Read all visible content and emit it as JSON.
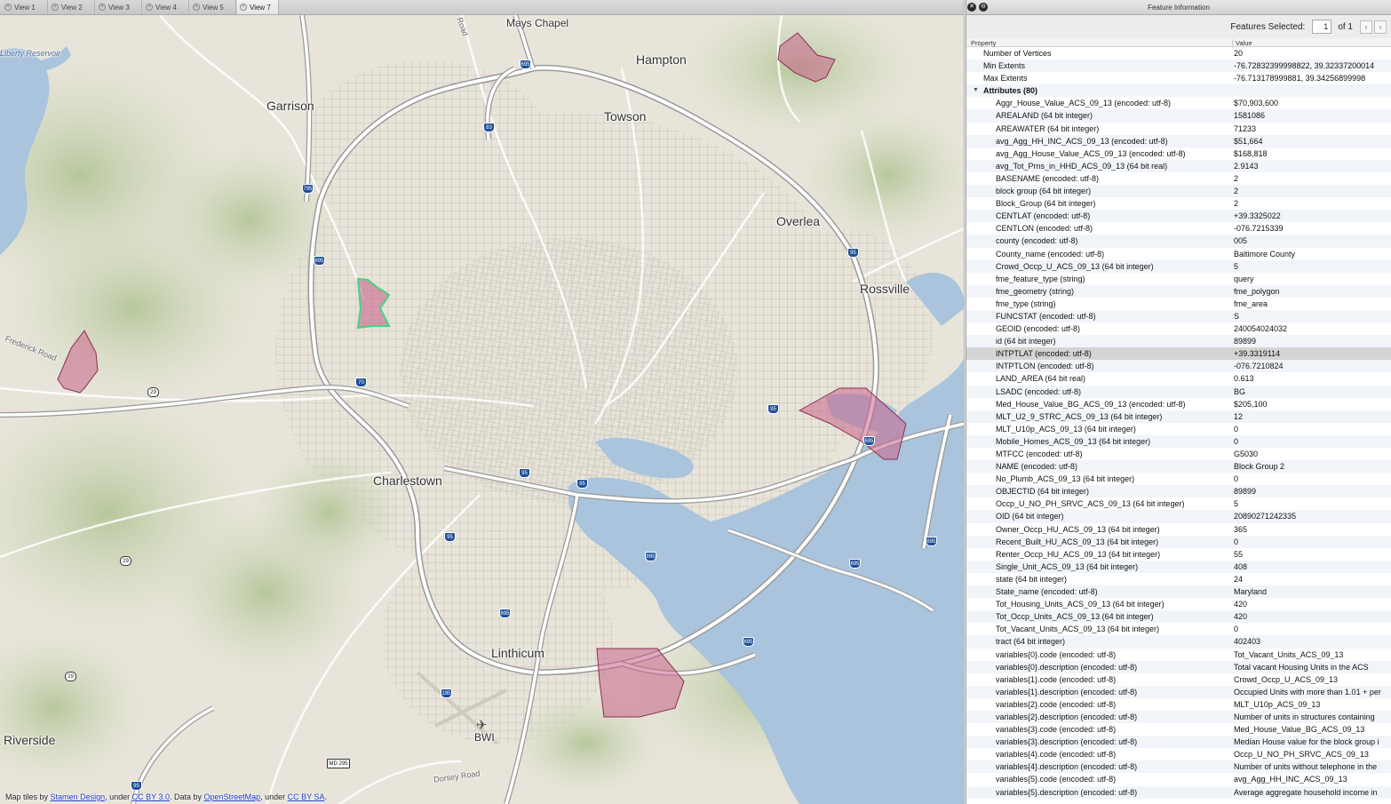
{
  "tabs": [
    "View 1",
    "View 2",
    "View 3",
    "View 4",
    "View 5",
    "View 7"
  ],
  "active_tab": "View 7",
  "map": {
    "places": [
      {
        "name": "Mays Chapel"
      },
      {
        "name": "Hampton"
      },
      {
        "name": "Garrison"
      },
      {
        "name": "Towson"
      },
      {
        "name": "Overlea"
      },
      {
        "name": "Rossville"
      },
      {
        "name": "Charlestown"
      },
      {
        "name": "Linthicum"
      },
      {
        "name": "Riverside"
      },
      {
        "name": "BWI"
      },
      {
        "name": "Liberty Reservoir"
      },
      {
        "name": "Frederick Road"
      },
      {
        "name": "Dorsey Road"
      },
      {
        "name": "Road"
      }
    ],
    "shields": [
      "695",
      "83",
      "795",
      "695",
      "70",
      "29",
      "95",
      "95",
      "95",
      "95",
      "895",
      "695",
      "695",
      "695",
      "695",
      "695",
      "195",
      "29",
      "29",
      "95",
      "MD 295",
      "95"
    ],
    "credits": {
      "prefix": "Map tiles by",
      "stamen": "Stamen Design",
      "under1": ", under",
      "cc1": "CC BY 3.0",
      "data_by": ". Data by",
      "osm": "OpenStreetMap",
      "under2": ", under",
      "cc2": "CC BY SA",
      "end": "."
    },
    "colors": {
      "water": "#a9c4dc",
      "highlight_fill": "#c8648a",
      "selected_outline": "#4fd08a",
      "highway": "#ffffff",
      "terrain": "#c9d6b2"
    }
  },
  "panel": {
    "title": "Feature Information",
    "features_selected_label": "Features Selected:",
    "feature_index": "1",
    "of_label": "of 1",
    "prev_icon": "‹",
    "next_icon": "›",
    "header_property": "Property",
    "header_value": "Value",
    "rows": [
      {
        "name": "Number of Vertices",
        "value": "20",
        "type": "top"
      },
      {
        "name": "Min Extents",
        "value": "-76.72832399998822, 39.32337200014",
        "type": "top"
      },
      {
        "name": "Max Extents",
        "value": "-76.713178999881, 39.34256899998",
        "type": "top"
      },
      {
        "name": "Attributes (80)",
        "value": "",
        "type": "group"
      },
      {
        "name": "Aggr_House_Value_ACS_09_13 (encoded: utf-8)",
        "value": "$70,903,600"
      },
      {
        "name": "AREALAND (64 bit integer)",
        "value": "1581086"
      },
      {
        "name": "AREAWATER (64 bit integer)",
        "value": "71233"
      },
      {
        "name": "avg_Agg_HH_INC_ACS_09_13 (encoded: utf-8)",
        "value": "$51,664"
      },
      {
        "name": "avg_Agg_House_Value_ACS_09_13 (encoded: utf-8)",
        "value": "$168,818"
      },
      {
        "name": "avg_Tot_Prns_in_HHD_ACS_09_13 (64 bit real)",
        "value": "2.9143"
      },
      {
        "name": "BASENAME (encoded: utf-8)",
        "value": "2"
      },
      {
        "name": "block group (64 bit integer)",
        "value": "2"
      },
      {
        "name": "Block_Group (64 bit integer)",
        "value": "2"
      },
      {
        "name": "CENTLAT (encoded: utf-8)",
        "value": "+39.3325022"
      },
      {
        "name": "CENTLON (encoded: utf-8)",
        "value": "-076.7215339"
      },
      {
        "name": "county (encoded: utf-8)",
        "value": "005"
      },
      {
        "name": "County_name (encoded: utf-8)",
        "value": "Baltimore County"
      },
      {
        "name": "Crowd_Occp_U_ACS_09_13 (64 bit integer)",
        "value": "5"
      },
      {
        "name": "fme_feature_type (string)",
        "value": "query"
      },
      {
        "name": "fme_geometry (string)",
        "value": "fme_polygon"
      },
      {
        "name": "fme_type (string)",
        "value": "fme_area"
      },
      {
        "name": "FUNCSTAT (encoded: utf-8)",
        "value": "S"
      },
      {
        "name": "GEOID (encoded: utf-8)",
        "value": "240054024032"
      },
      {
        "name": "id (64 bit integer)",
        "value": "89899"
      },
      {
        "name": "INTPTLAT (encoded: utf-8)",
        "value": "+39.3319114",
        "type": "selected"
      },
      {
        "name": "INTPTLON (encoded: utf-8)",
        "value": "-076.7210824"
      },
      {
        "name": "LAND_AREA (64 bit real)",
        "value": "0.613"
      },
      {
        "name": "LSADC (encoded: utf-8)",
        "value": "BG"
      },
      {
        "name": "Med_House_Value_BG_ACS_09_13 (encoded: utf-8)",
        "value": "$205,100"
      },
      {
        "name": "MLT_U2_9_STRC_ACS_09_13 (64 bit integer)",
        "value": "12"
      },
      {
        "name": "MLT_U10p_ACS_09_13 (64 bit integer)",
        "value": "0"
      },
      {
        "name": "Mobile_Homes_ACS_09_13 (64 bit integer)",
        "value": "0"
      },
      {
        "name": "MTFCC (encoded: utf-8)",
        "value": "G5030"
      },
      {
        "name": "NAME (encoded: utf-8)",
        "value": "Block Group 2"
      },
      {
        "name": "No_Plumb_ACS_09_13 (64 bit integer)",
        "value": "0"
      },
      {
        "name": "OBJECTID (64 bit integer)",
        "value": "89899"
      },
      {
        "name": "Occp_U_NO_PH_SRVC_ACS_09_13 (64 bit integer)",
        "value": "5"
      },
      {
        "name": "OID (64 bit integer)",
        "value": "20890271242335"
      },
      {
        "name": "Owner_Occp_HU_ACS_09_13 (64 bit integer)",
        "value": "365"
      },
      {
        "name": "Recent_Built_HU_ACS_09_13 (64 bit integer)",
        "value": "0"
      },
      {
        "name": "Renter_Occp_HU_ACS_09_13 (64 bit integer)",
        "value": "55"
      },
      {
        "name": "Single_Unit_ACS_09_13 (64 bit integer)",
        "value": "408"
      },
      {
        "name": "state (64 bit integer)",
        "value": "24"
      },
      {
        "name": "State_name (encoded: utf-8)",
        "value": "Maryland"
      },
      {
        "name": "Tot_Housing_Units_ACS_09_13 (64 bit integer)",
        "value": "420"
      },
      {
        "name": "Tot_Occp_Units_ACS_09_13 (64 bit integer)",
        "value": "420"
      },
      {
        "name": "Tot_Vacant_Units_ACS_09_13 (64 bit integer)",
        "value": "0"
      },
      {
        "name": "tract (64 bit integer)",
        "value": "402403"
      },
      {
        "name": "variables{0}.code (encoded: utf-8)",
        "value": "Tot_Vacant_Units_ACS_09_13"
      },
      {
        "name": "variables{0}.description (encoded: utf-8)",
        "value": "Total vacant Housing Units in the ACS"
      },
      {
        "name": "variables{1}.code (encoded: utf-8)",
        "value": "Crowd_Occp_U_ACS_09_13"
      },
      {
        "name": "variables{1}.description (encoded: utf-8)",
        "value": "Occupied Units with more than 1.01 + per"
      },
      {
        "name": "variables{2}.code (encoded: utf-8)",
        "value": "MLT_U10p_ACS_09_13"
      },
      {
        "name": "variables{2}.description (encoded: utf-8)",
        "value": "Number of units in structures containing"
      },
      {
        "name": "variables{3}.code (encoded: utf-8)",
        "value": "Med_House_Value_BG_ACS_09_13"
      },
      {
        "name": "variables{3}.description (encoded: utf-8)",
        "value": "Median House value for the block group i"
      },
      {
        "name": "variables{4}.code (encoded: utf-8)",
        "value": "Occp_U_NO_PH_SRVC_ACS_09_13"
      },
      {
        "name": "variables{4}.description (encoded: utf-8)",
        "value": "Number of units without telephone in the"
      },
      {
        "name": "variables{5}.code (encoded: utf-8)",
        "value": "avg_Agg_HH_INC_ACS_09_13"
      },
      {
        "name": "variables{5}.description (encoded: utf-8)",
        "value": "Average aggregate household income in"
      }
    ]
  }
}
